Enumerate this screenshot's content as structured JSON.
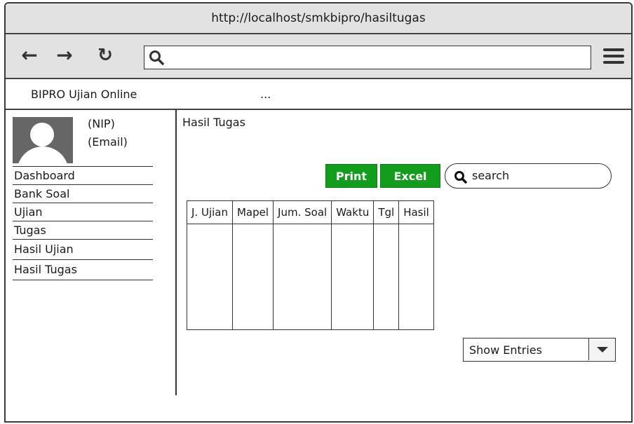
{
  "browser": {
    "url": "http://localhost/smkbipro/hasiltugas",
    "search_placeholder": ""
  },
  "app": {
    "brand": "BIPRO Ujian Online",
    "ellipsis": "..."
  },
  "profile": {
    "nip": "(NIP)",
    "email": "(Email)"
  },
  "sidebar": {
    "items": [
      {
        "label": "Dashboard"
      },
      {
        "label": "Bank Soal"
      },
      {
        "label": "Ujian"
      },
      {
        "label": "Tugas"
      },
      {
        "label": "Hasil Ujian"
      },
      {
        "label": "Hasil Tugas"
      }
    ]
  },
  "content": {
    "title": "Hasil Tugas",
    "print_label": "Print",
    "excel_label": "Excel",
    "search_placeholder": "search",
    "columns": [
      "J. Ujian",
      "Mapel",
      "Jum. Soal",
      "Waktu",
      "Tgl",
      "Hasil"
    ],
    "show_entries_label": "Show Entries"
  },
  "colors": {
    "button_green": "#129e1c",
    "chrome_gray": "#e2e2e2"
  },
  "icons": [
    "back-arrow-icon",
    "forward-arrow-icon",
    "refresh-icon",
    "search-icon",
    "hamburger-menu-icon",
    "user-avatar-icon",
    "dropdown-caret-icon"
  ]
}
